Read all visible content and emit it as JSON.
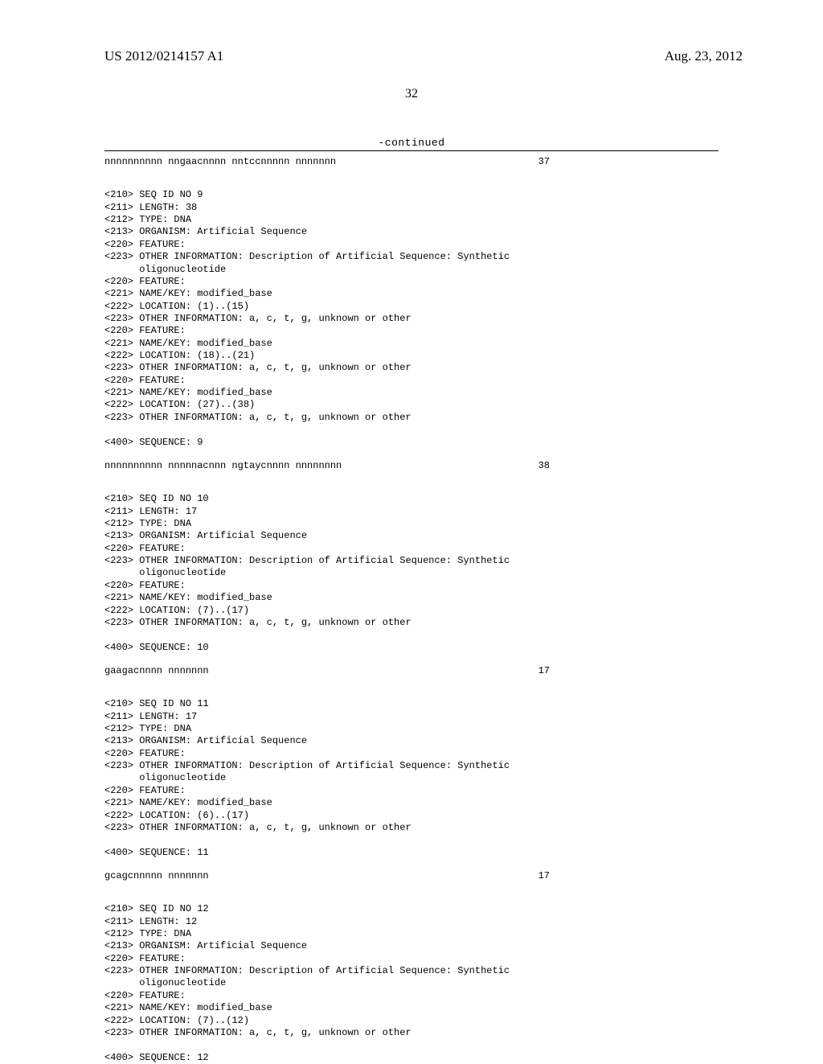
{
  "header": {
    "pubnum": "US 2012/0214157 A1",
    "date": "Aug. 23, 2012"
  },
  "pagenum": "32",
  "continued": "-continued",
  "seq8": {
    "text": "nnnnnnnnnn nngaacnnnn nntccnnnnn nnnnnnn",
    "len": "37"
  },
  "block9_lines": "<210> SEQ ID NO 9\n<211> LENGTH: 38\n<212> TYPE: DNA\n<213> ORGANISM: Artificial Sequence\n<220> FEATURE:\n<223> OTHER INFORMATION: Description of Artificial Sequence: Synthetic\n      oligonucleotide\n<220> FEATURE:\n<221> NAME/KEY: modified_base\n<222> LOCATION: (1)..(15)\n<223> OTHER INFORMATION: a, c, t, g, unknown or other\n<220> FEATURE:\n<221> NAME/KEY: modified_base\n<222> LOCATION: (18)..(21)\n<223> OTHER INFORMATION: a, c, t, g, unknown or other\n<220> FEATURE:\n<221> NAME/KEY: modified_base\n<222> LOCATION: (27)..(38)\n<223> OTHER INFORMATION: a, c, t, g, unknown or other\n\n<400> SEQUENCE: 9",
  "seq9": {
    "text": "nnnnnnnnnn nnnnnacnnn ngtaycnnnn nnnnnnnn",
    "len": "38"
  },
  "block10_lines": "<210> SEQ ID NO 10\n<211> LENGTH: 17\n<212> TYPE: DNA\n<213> ORGANISM: Artificial Sequence\n<220> FEATURE:\n<223> OTHER INFORMATION: Description of Artificial Sequence: Synthetic\n      oligonucleotide\n<220> FEATURE:\n<221> NAME/KEY: modified_base\n<222> LOCATION: (7)..(17)\n<223> OTHER INFORMATION: a, c, t, g, unknown or other\n\n<400> SEQUENCE: 10",
  "seq10": {
    "text": "gaagacnnnn nnnnnnn",
    "len": "17"
  },
  "block11_lines": "<210> SEQ ID NO 11\n<211> LENGTH: 17\n<212> TYPE: DNA\n<213> ORGANISM: Artificial Sequence\n<220> FEATURE:\n<223> OTHER INFORMATION: Description of Artificial Sequence: Synthetic\n      oligonucleotide\n<220> FEATURE:\n<221> NAME/KEY: modified_base\n<222> LOCATION: (6)..(17)\n<223> OTHER INFORMATION: a, c, t, g, unknown or other\n\n<400> SEQUENCE: 11",
  "seq11": {
    "text": "gcagcnnnnn nnnnnnn",
    "len": "17"
  },
  "block12_lines": "<210> SEQ ID NO 12\n<211> LENGTH: 12\n<212> TYPE: DNA\n<213> ORGANISM: Artificial Sequence\n<220> FEATURE:\n<223> OTHER INFORMATION: Description of Artificial Sequence: Synthetic\n      oligonucleotide\n<220> FEATURE:\n<221> NAME/KEY: modified_base\n<222> LOCATION: (7)..(12)\n<223> OTHER INFORMATION: a, c, t, g, unknown or other\n\n<400> SEQUENCE: 12"
}
